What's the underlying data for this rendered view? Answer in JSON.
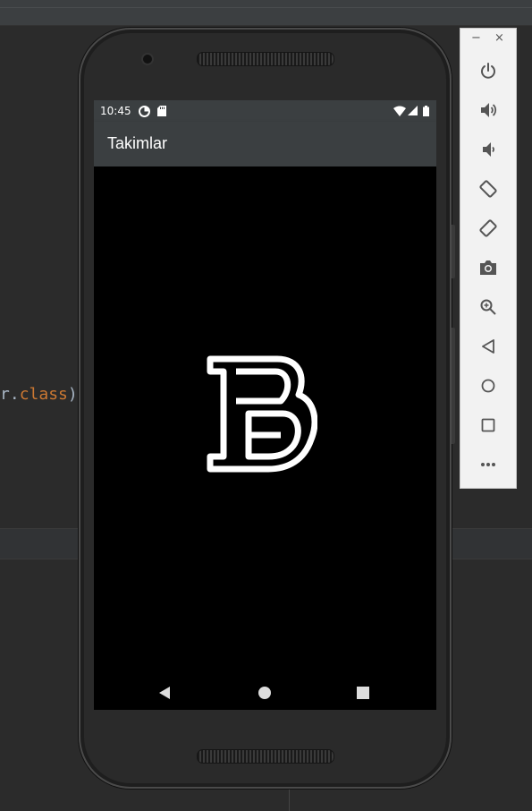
{
  "ide": {
    "code_fragment_prefix": "r.",
    "code_fragment_keyword": "class",
    "code_fragment_suffix": ")"
  },
  "status_bar": {
    "time": "10:45",
    "icons": [
      "data-saver-icon",
      "sd-card-icon",
      "wifi-icon",
      "signal-icon",
      "battery-icon"
    ]
  },
  "app_bar": {
    "title": "Takimlar"
  },
  "content": {
    "logo_letter": "B",
    "logo_icon": "letter-b-logo-icon"
  },
  "nav_bar": {
    "buttons": [
      "back-icon",
      "home-icon",
      "recents-icon"
    ]
  },
  "emulator_panel": {
    "window_controls": [
      "minimize-icon",
      "close-icon"
    ],
    "buttons": [
      "power-icon",
      "volume-up-icon",
      "volume-down-icon",
      "rotate-left-icon",
      "rotate-right-icon",
      "camera-icon",
      "zoom-icon",
      "back-icon",
      "home-icon",
      "overview-icon",
      "more-icon"
    ]
  },
  "colors": {
    "ide_background": "#2b2b2b",
    "app_bar": "#3b3f41",
    "screen_background": "#000000",
    "keyword": "#cc7832"
  }
}
